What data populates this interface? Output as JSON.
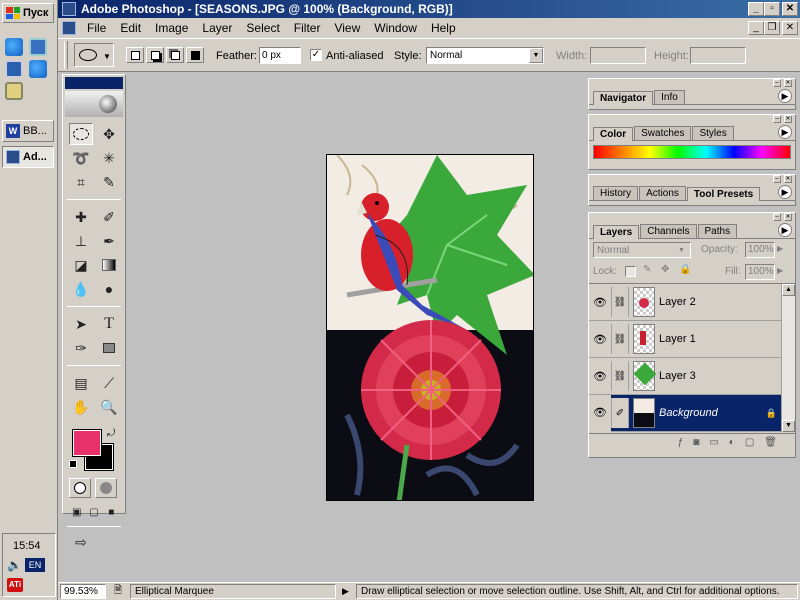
{
  "taskbar": {
    "start_label": "Пуск",
    "tasks": [
      {
        "label": "BB..."
      },
      {
        "label": "Ad..."
      }
    ],
    "clock": "15:54",
    "language": "EN"
  },
  "window": {
    "title": "Adobe Photoshop - [SEASONS.JPG @ 100% (Background, RGB)]"
  },
  "menu": [
    "File",
    "Edit",
    "Image",
    "Layer",
    "Select",
    "Filter",
    "View",
    "Window",
    "Help"
  ],
  "options": {
    "feather_label": "Feather:",
    "feather_value": "0 px",
    "antialiased_label": "Anti-aliased",
    "antialiased_checked": true,
    "style_label": "Style:",
    "style_value": "Normal",
    "width_label": "Width:",
    "height_label": "Height:"
  },
  "palettes": {
    "navigator": {
      "tabs": [
        "Navigator",
        "Info"
      ]
    },
    "color": {
      "tabs": [
        "Color",
        "Swatches",
        "Styles"
      ]
    },
    "history": {
      "tabs": [
        "History",
        "Actions",
        "Tool Presets"
      ]
    },
    "layers": {
      "tabs": [
        "Layers",
        "Channels",
        "Paths"
      ],
      "blend_mode": "Normal",
      "opacity_label": "Opacity:",
      "opacity_value": "100%",
      "lock_label": "Lock:",
      "fill_label": "Fill:",
      "fill_value": "100%",
      "items": [
        {
          "name": "Layer 2",
          "selected": false
        },
        {
          "name": "Layer 1",
          "selected": false
        },
        {
          "name": "Layer 3",
          "selected": false
        },
        {
          "name": "Background",
          "selected": true
        }
      ]
    }
  },
  "status": {
    "zoom": "99.53%",
    "tool": "Elliptical Marquee",
    "hint": "Draw elliptical selection or move selection outline.  Use Shift, Alt, and Ctrl for additional options."
  },
  "colors": {
    "foreground": "#e8306a",
    "background": "#000000",
    "title_bar": "#0a246a"
  }
}
